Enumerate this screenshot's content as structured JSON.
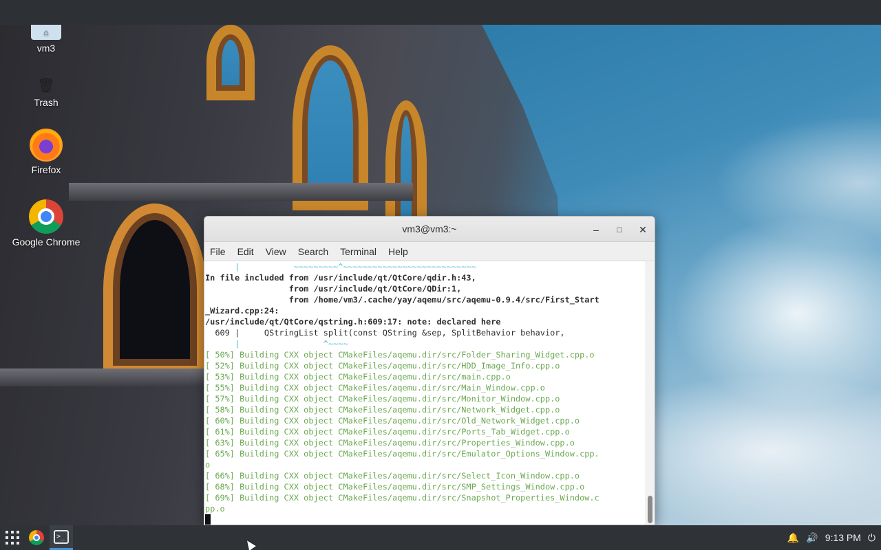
{
  "desktop": {
    "icons": [
      {
        "label": "vm3",
        "icon": "home-folder-icon"
      },
      {
        "label": "Trash",
        "icon": "trash-icon"
      },
      {
        "label": "Firefox",
        "icon": "firefox-icon"
      },
      {
        "label": "Google Chrome",
        "icon": "chrome-icon"
      }
    ]
  },
  "window": {
    "title": "vm3@vm3:~",
    "buttons": {
      "minimize": "–",
      "maximize": "□",
      "close": "✕"
    },
    "menu": [
      "File",
      "Edit",
      "View",
      "Search",
      "Terminal",
      "Help"
    ]
  },
  "terminal": {
    "lines": [
      "      |           ~~~~~~~~~^~~~~~~~~~~~~~~~~~~~~~~~~~~~",
      "In file included from /usr/include/qt/QtCore/qdir.h:43,",
      "                 from /usr/include/qt/QtCore/QDir:1,",
      "                 from /home/vm3/.cache/yay/aqemu/src/aqemu-0.9.4/src/First_Start",
      "_Wizard.cpp:24:",
      "/usr/include/qt/QtCore/qstring.h:609:17: note: declared here",
      "  609 |     QStringList split(const QString &sep, SplitBehavior behavior,",
      "      |                 ^~~~~",
      "[ 50%] Building CXX object CMakeFiles/aqemu.dir/src/Folder_Sharing_Widget.cpp.o",
      "[ 52%] Building CXX object CMakeFiles/aqemu.dir/src/HDD_Image_Info.cpp.o",
      "[ 53%] Building CXX object CMakeFiles/aqemu.dir/src/main.cpp.o",
      "[ 55%] Building CXX object CMakeFiles/aqemu.dir/src/Main_Window.cpp.o",
      "[ 57%] Building CXX object CMakeFiles/aqemu.dir/src/Monitor_Window.cpp.o",
      "[ 58%] Building CXX object CMakeFiles/aqemu.dir/src/Network_Widget.cpp.o",
      "[ 60%] Building CXX object CMakeFiles/aqemu.dir/src/Old_Network_Widget.cpp.o",
      "[ 61%] Building CXX object CMakeFiles/aqemu.dir/src/Ports_Tab_Widget.cpp.o",
      "[ 63%] Building CXX object CMakeFiles/aqemu.dir/src/Properties_Window.cpp.o",
      "[ 65%] Building CXX object CMakeFiles/aqemu.dir/src/Emulator_Options_Window.cpp.",
      "o",
      "[ 66%] Building CXX object CMakeFiles/aqemu.dir/src/Select_Icon_Window.cpp.o",
      "[ 68%] Building CXX object CMakeFiles/aqemu.dir/src/SMP_Settings_Window.cpp.o",
      "[ 69%] Building CXX object CMakeFiles/aqemu.dir/src/Snapshot_Properties_Window.c",
      "pp.o"
    ]
  },
  "taskbar": {
    "clock": "9:13 PM",
    "apps": [
      "apps-grid-icon",
      "chrome-icon",
      "terminal-icon"
    ],
    "tray": [
      "bell-icon",
      "volume-icon",
      "power-icon"
    ]
  },
  "colors": {
    "build_green": "#6aa84f",
    "note_cyan": "#2ab0c4",
    "taskbar_active": "#4a90d9"
  }
}
